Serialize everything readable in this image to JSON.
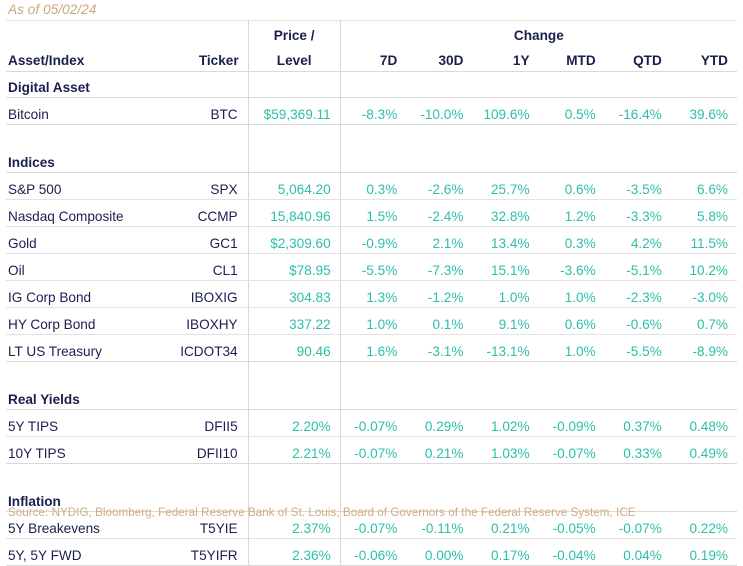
{
  "header": {
    "as_of": "As of 05/02/24",
    "columns": {
      "asset": "Asset/Index",
      "ticker": "Ticker",
      "price_line1": "Price /",
      "price_line2": "Level",
      "change_group": "Change",
      "chg": [
        "7D",
        "30D",
        "1Y",
        "MTD",
        "QTD",
        "YTD"
      ]
    }
  },
  "colors": {
    "value_teal": "#2dbfa8",
    "label_navy": "#1a1f4e",
    "accent_tan": "#d0ab7e",
    "rule_gray": "#d9d9d9"
  },
  "sections": [
    {
      "title": "Digital Asset",
      "rows": [
        {
          "asset": "Bitcoin",
          "ticker": "BTC",
          "price": "$59,369.11",
          "changes": [
            "-8.3%",
            "-10.0%",
            "109.6%",
            "0.5%",
            "-16.4%",
            "39.6%"
          ]
        }
      ]
    },
    {
      "title": "Indices",
      "rows": [
        {
          "asset": "S&P 500",
          "ticker": "SPX",
          "price": "5,064.20",
          "changes": [
            "0.3%",
            "-2.6%",
            "25.7%",
            "0.6%",
            "-3.5%",
            "6.6%"
          ]
        },
        {
          "asset": "Nasdaq Composite",
          "ticker": "CCMP",
          "price": "15,840.96",
          "changes": [
            "1.5%",
            "-2.4%",
            "32.8%",
            "1.2%",
            "-3.3%",
            "5.8%"
          ]
        },
        {
          "asset": "Gold",
          "ticker": "GC1",
          "price": "$2,309.60",
          "changes": [
            "-0.9%",
            "2.1%",
            "13.4%",
            "0.3%",
            "4.2%",
            "11.5%"
          ]
        },
        {
          "asset": "Oil",
          "ticker": "CL1",
          "price": "$78.95",
          "changes": [
            "-5.5%",
            "-7.3%",
            "15.1%",
            "-3.6%",
            "-5.1%",
            "10.2%"
          ]
        },
        {
          "asset": "IG Corp Bond",
          "ticker": "IBOXIG",
          "price": "304.83",
          "changes": [
            "1.3%",
            "-1.2%",
            "1.0%",
            "1.0%",
            "-2.3%",
            "-3.0%"
          ]
        },
        {
          "asset": "HY Corp Bond",
          "ticker": "IBOXHY",
          "price": "337.22",
          "changes": [
            "1.0%",
            "0.1%",
            "9.1%",
            "0.6%",
            "-0.6%",
            "0.7%"
          ]
        },
        {
          "asset": "LT US Treasury",
          "ticker": "ICDOT34",
          "price": "90.46",
          "changes": [
            "1.6%",
            "-3.1%",
            "-13.1%",
            "1.0%",
            "-5.5%",
            "-8.9%"
          ]
        }
      ]
    },
    {
      "title": "Real Yields",
      "rows": [
        {
          "asset": "5Y TIPS",
          "ticker": "DFII5",
          "price": "2.20%",
          "changes": [
            "-0.07%",
            "0.29%",
            "1.02%",
            "-0.09%",
            "0.37%",
            "0.48%"
          ]
        },
        {
          "asset": "10Y TIPS",
          "ticker": "DFII10",
          "price": "2.21%",
          "changes": [
            "-0.07%",
            "0.21%",
            "1.03%",
            "-0.07%",
            "0.33%",
            "0.49%"
          ]
        }
      ]
    },
    {
      "title": "Inflation",
      "rows": [
        {
          "asset": "5Y Breakevens",
          "ticker": "T5YIE",
          "price": "2.37%",
          "changes": [
            "-0.07%",
            "-0.11%",
            "0.21%",
            "-0.05%",
            "-0.07%",
            "0.22%"
          ]
        },
        {
          "asset": "5Y, 5Y FWD",
          "ticker": "T5YIFR",
          "price": "2.36%",
          "changes": [
            "-0.06%",
            "0.00%",
            "0.17%",
            "-0.04%",
            "0.04%",
            "0.19%"
          ]
        }
      ]
    }
  ],
  "footer": {
    "source": "Source: NYDIG, Bloomberg, Federal Reserve Bank of St. Louis, Board of Governors of the Federal Reserve System, ICE"
  }
}
